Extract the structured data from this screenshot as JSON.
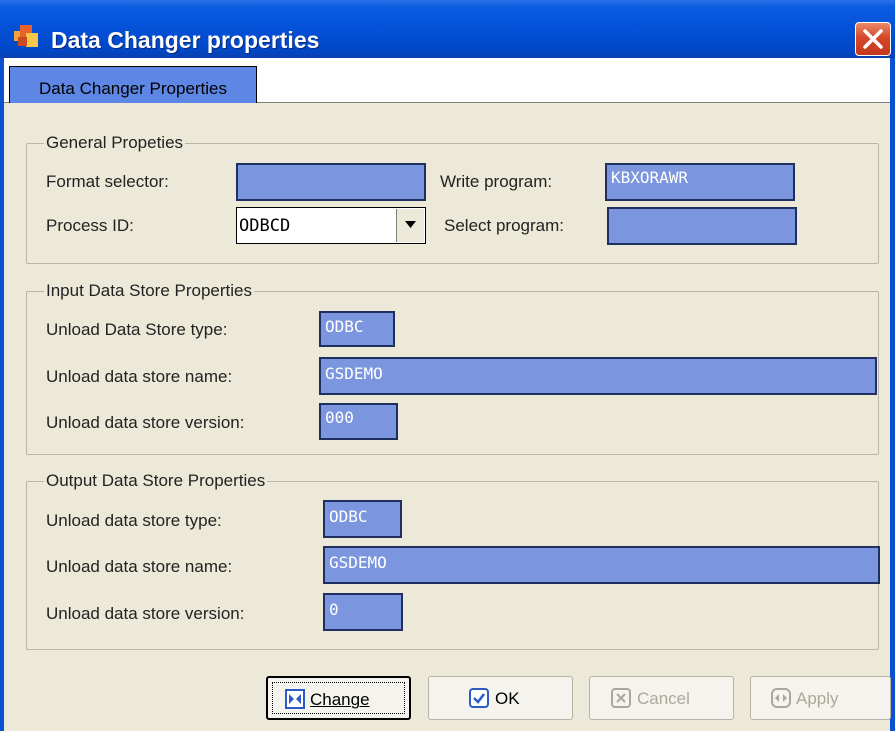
{
  "window": {
    "title": "Data Changer properties",
    "close_icon": "close-icon"
  },
  "tabs": [
    {
      "label": "Data Changer Properties",
      "active": true
    }
  ],
  "general": {
    "title": "General Propeties",
    "format_selector_label": "Format selector:",
    "format_selector_value": "",
    "write_program_label": "Write program:",
    "write_program_value": "KBXORAWR",
    "process_id_label": "Process ID:",
    "process_id_value": "ODBCD",
    "select_program_label": "Select program:",
    "select_program_value": ""
  },
  "input_store": {
    "title": "Input Data Store Properties",
    "type_label": "Unload Data Store type:",
    "type_value": "ODBC",
    "name_label": "Unload data store name:",
    "name_value": "GSDEMO",
    "version_label": "Unload data store version:",
    "version_value": "000"
  },
  "output_store": {
    "title": "Output Data Store Properties",
    "type_label": "Unload data store type:",
    "type_value": "ODBC",
    "name_label": "Unload data store name:",
    "name_value": "GSDEMO",
    "version_label": "Unload data store version:",
    "version_value": "0"
  },
  "buttons": {
    "change": {
      "label": "Change",
      "icon": "change-icon"
    },
    "ok": {
      "label": "OK",
      "icon": "check-icon"
    },
    "cancel": {
      "label": "Cancel",
      "icon": "x-icon",
      "disabled": true
    },
    "apply": {
      "label": "Apply",
      "icon": "apply-icon",
      "disabled": true
    }
  },
  "colors": {
    "field_bg": "#7B96DE",
    "titlebar": "#0450D6",
    "tab_active": "#5E86E4",
    "panel_bg": "#ECE9D8"
  }
}
